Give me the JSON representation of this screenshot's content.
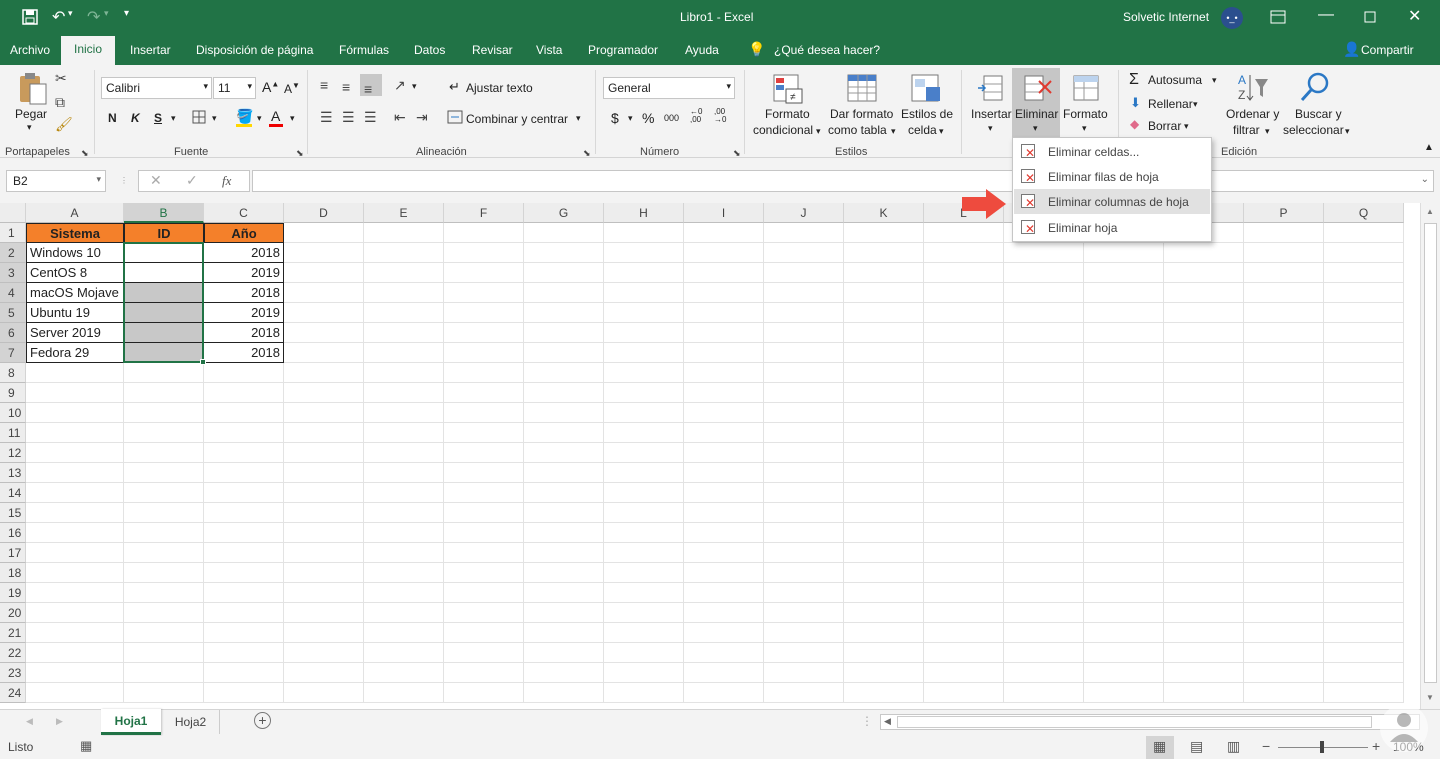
{
  "window": {
    "title": "Libro1 - Excel",
    "user": "Solvetic Internet",
    "user_badge": "•_•"
  },
  "menu_tabs": [
    "Archivo",
    "Inicio",
    "Insertar",
    "Disposición de página",
    "Fórmulas",
    "Datos",
    "Revisar",
    "Vista",
    "Programador",
    "Ayuda"
  ],
  "tell_me": "¿Qué desea hacer?",
  "share": "Compartir",
  "ribbon": {
    "paste": "Pegar",
    "font_name": "Calibri",
    "font_size": "11",
    "bold": "N",
    "italic": "K",
    "underline": "S",
    "wrap_text": "Ajustar texto",
    "merge_center": "Combinar y centrar",
    "number_format": "General",
    "cond_format": [
      "Formato",
      "condicional"
    ],
    "format_table": [
      "Dar formato",
      "como tabla"
    ],
    "cell_styles": [
      "Estilos de",
      "celda"
    ],
    "insert": "Insertar",
    "delete": "Eliminar",
    "format": "Formato",
    "autosum": "Autosuma",
    "fill": "Rellenar",
    "clear": "Borrar",
    "sort_filter": [
      "Ordenar y",
      "filtrar"
    ],
    "find_select": [
      "Buscar y",
      "seleccionar"
    ],
    "groups": [
      "Portapapeles",
      "Fuente",
      "Alineación",
      "Número",
      "Estilos",
      "Edición"
    ]
  },
  "name_box": "B2",
  "fx": "fx",
  "columns": [
    "A",
    "B",
    "C",
    "D",
    "E",
    "F",
    "G",
    "H",
    "I",
    "J",
    "K",
    "L",
    "M",
    "N",
    "O",
    "P",
    "Q"
  ],
  "rows": [
    "1",
    "2",
    "3",
    "4",
    "5",
    "6",
    "7",
    "8",
    "9",
    "10",
    "11",
    "12",
    "13",
    "14",
    "15",
    "16",
    "17",
    "18",
    "19",
    "20",
    "21",
    "22",
    "23",
    "24"
  ],
  "table": {
    "headers": [
      "Sistema",
      "ID",
      "Año"
    ],
    "rows": [
      [
        "Windows 10",
        "",
        "2018"
      ],
      [
        "CentOS 8",
        "",
        "2019"
      ],
      [
        "macOS Mojave",
        "",
        "2018"
      ],
      [
        "Ubuntu 19",
        "",
        "2019"
      ],
      [
        "Server 2019",
        "",
        "2018"
      ],
      [
        "Fedora 29",
        "",
        "2018"
      ]
    ]
  },
  "delete_menu": [
    "Eliminar celdas...",
    "Eliminar filas de hoja",
    "Eliminar columnas de hoja",
    "Eliminar hoja"
  ],
  "sheets": [
    "Hoja1",
    "Hoja2"
  ],
  "status": {
    "ready": "Listo",
    "zoom": "100%"
  },
  "colors": {
    "brand": "#217346",
    "header_fill": "#f4802a",
    "selection": "#c8c8c8",
    "arrow": "#ee4b3e"
  }
}
